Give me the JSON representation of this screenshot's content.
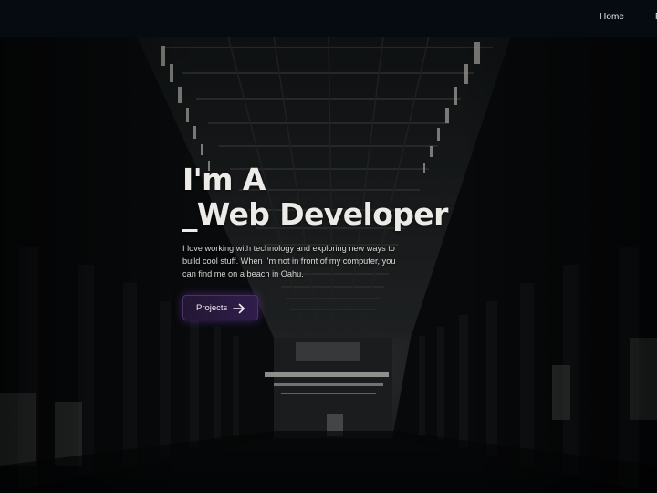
{
  "nav": {
    "home_label": "Home",
    "next_label": "P"
  },
  "hero": {
    "line1": "I'm A",
    "line2": "_Web Developer",
    "description": "I love working with technology and exploring new ways to build cool stuff. When I'm not in front of my computer, you can find me on a beach in Oahu.",
    "button_label": "Projects",
    "button_icon": "arrow-right-icon"
  },
  "colors": {
    "nav_background": "#060a11",
    "button_accent": "#301d4c",
    "button_glow": "#7a3cbe"
  }
}
